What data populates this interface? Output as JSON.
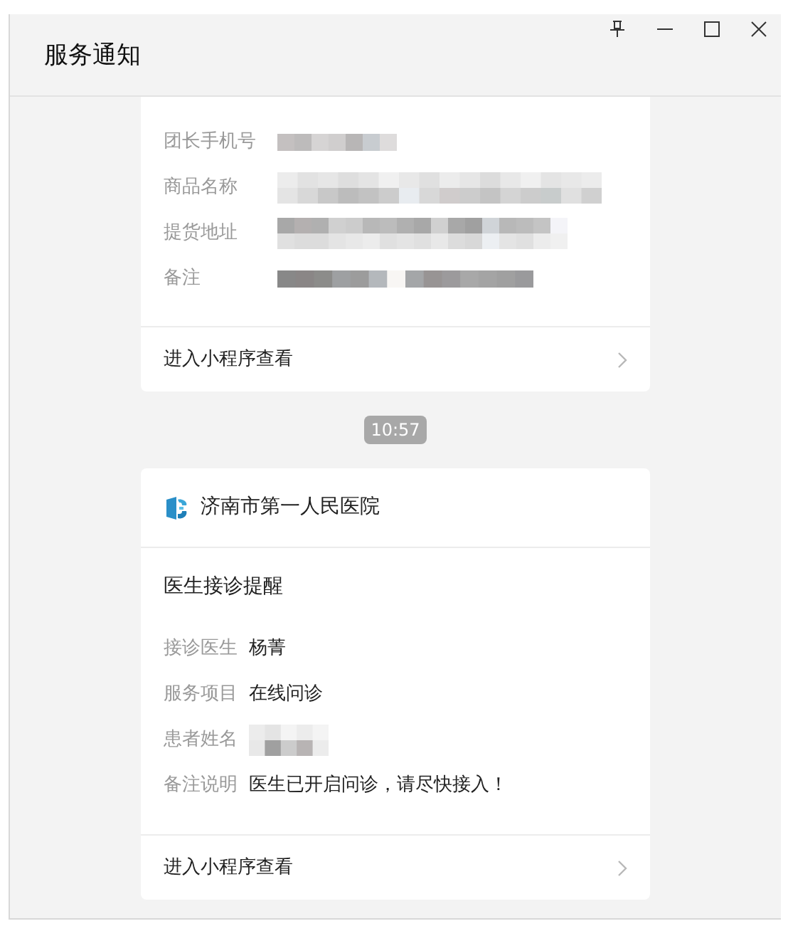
{
  "window": {
    "title": "服务通知"
  },
  "messages": [
    {
      "kind": "plain",
      "fields": [
        {
          "label": "团长手机号",
          "kind": "redacted"
        },
        {
          "label": "商品名称",
          "kind": "redacted"
        },
        {
          "label": "提货地址",
          "kind": "redacted"
        },
        {
          "label": "备注",
          "kind": "redacted"
        }
      ],
      "link": "进入小程序查看"
    },
    {
      "kind": "service",
      "time": "10:57",
      "sender": "济南市第一人民医院",
      "heading": "医生接诊提醒",
      "fields": [
        {
          "label": "接诊医生",
          "kind": "text",
          "value": "杨菁"
        },
        {
          "label": "服务项目",
          "kind": "text",
          "value": "在线问诊"
        },
        {
          "label": "患者姓名",
          "kind": "redacted"
        },
        {
          "label": "备注说明",
          "kind": "text",
          "value": "医生已开启问诊，请尽快接入！"
        }
      ],
      "link": "进入小程序查看"
    }
  ]
}
